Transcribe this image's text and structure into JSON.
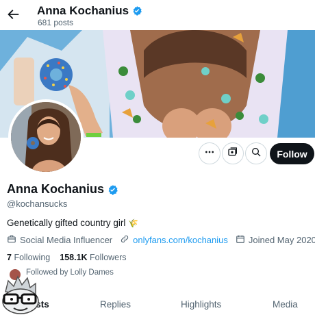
{
  "header": {
    "name": "Anna Kochanius",
    "post_count": "681 posts",
    "back_icon": "arrow-left-icon"
  },
  "profile": {
    "name": "Anna Kochanius",
    "handle": "@kochansucks",
    "verified": true,
    "bio": "Genetically gifted country girl",
    "bio_emoji": "🌾",
    "category": "Social Media Influencer",
    "link": "onlyfans.com/kochanius",
    "joined": "Joined May 2020",
    "following_count": "7",
    "following_label": "Following",
    "followers_count": "158.1K",
    "followers_label": "Followers",
    "followed_by": "Followed by Lolly Dames"
  },
  "actions": {
    "more_icon": "more-icon",
    "subscribe_icon": "subscribe-icon",
    "search_icon": "search-icon",
    "follow_label": "Follow"
  },
  "tabs": [
    {
      "label": "Posts",
      "visible_label": "osts",
      "active": true
    },
    {
      "label": "Replies",
      "active": false
    },
    {
      "label": "Highlights",
      "active": false
    },
    {
      "label": "Media",
      "active": false
    }
  ],
  "colors": {
    "accent": "#1d9bf0",
    "text": "#0f1419",
    "muted": "#536471",
    "follow_bg": "#0f1419"
  }
}
